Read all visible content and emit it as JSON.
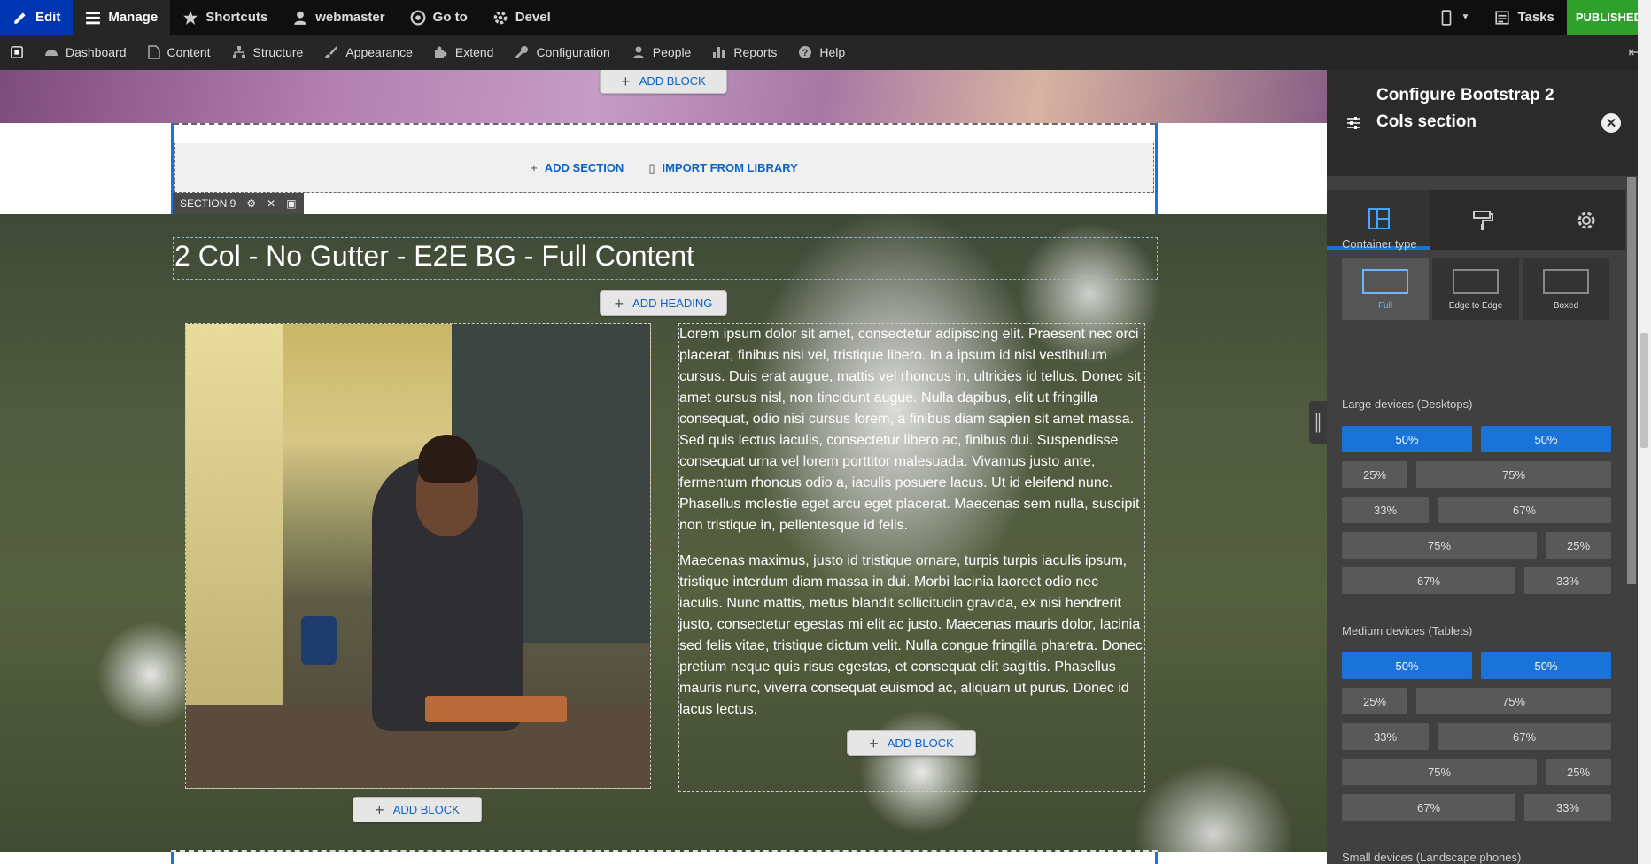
{
  "toolbar": {
    "edit": "Edit",
    "manage": "Manage",
    "shortcuts": "Shortcuts",
    "user": "webmaster",
    "goto": "Go to",
    "devel": "Devel",
    "tasks": "Tasks",
    "status": "PUBLISHED"
  },
  "tray": {
    "items": [
      "Dashboard",
      "Content",
      "Structure",
      "Appearance",
      "Extend",
      "Configuration",
      "People",
      "Reports",
      "Help"
    ]
  },
  "canvas": {
    "add_block": "ADD BLOCK",
    "add_section": "ADD SECTION",
    "import_library": "IMPORT FROM LIBRARY",
    "section_label": "SECTION 9",
    "heading": "2 Col - No Gutter - E2E BG - Full Content",
    "add_heading": "ADD HEADING",
    "paragraph1": "Lorem ipsum dolor sit amet, consectetur adipiscing elit. Praesent nec orci placerat, finibus nisi vel, tristique libero. In a ipsum id nisl vestibulum cursus. Duis erat augue, mattis vel rhoncus in, ultricies id tellus. Donec sit amet cursus nisl, non tincidunt augue. Nulla dapibus, elit ut fringilla consequat, odio nisi cursus lorem, a finibus diam sapien sit amet massa. Sed quis lectus iaculis, consectetur libero ac, finibus dui. Suspendisse consequat urna vel lorem porttitor malesuada. Vivamus justo ante, fermentum rhoncus odio a, iaculis posuere lacus. Ut id eleifend nunc. Phasellus molestie eget arcu eget placerat. Maecenas sem nulla, suscipit non tristique in, pellentesque id felis.",
    "paragraph2": "Maecenas maximus, justo id tristique ornare, turpis turpis iaculis ipsum, tristique interdum diam massa in dui. Morbi lacinia laoreet odio nec iaculis. Nunc mattis, metus blandit sollicitudin gravida, ex nisi hendrerit justo, consectetur egestas mi elit ac justo. Maecenas mauris dolor, lacinia sed felis vitae, tristique dictum velit. Nulla congue fringilla pharetra. Donec pretium neque quis risus egestas, et consequat elit sagittis. Phasellus mauris nunc, viverra consequat euismod ac, aliquam ut purus. Donec id lacus lectus."
  },
  "sidebar": {
    "title": "Configure Bootstrap 2 Cols section",
    "container_type_label": "Container type",
    "container_types": [
      "Full",
      "Edge to Edge",
      "Boxed"
    ],
    "selected_container": "Full",
    "large_label": "Large devices (Desktops)",
    "medium_label": "Medium devices (Tablets)",
    "small_label": "Small devices (Landscape phones)",
    "layouts": [
      [
        "50%",
        "50%"
      ],
      [
        "25%",
        "75%"
      ],
      [
        "33%",
        "67%"
      ],
      [
        "75%",
        "25%"
      ],
      [
        "67%",
        "33%"
      ]
    ]
  },
  "colors": {
    "toolbar_bg": "#0f0f0f",
    "tray_bg": "#262626",
    "accent": "#1a73d9",
    "published": "#2fa02c",
    "sidebar_bg": "#404040"
  }
}
